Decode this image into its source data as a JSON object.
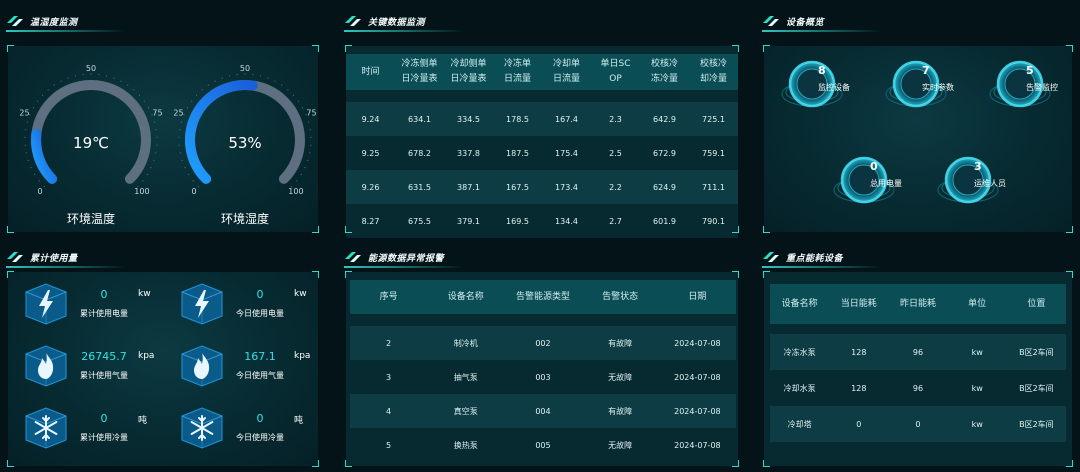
{
  "panels": {
    "temp_humidity": "温湿度监测",
    "key_data": "关键数据监测",
    "device_overview": "设备概览",
    "cumulative_usage": "累计使用量",
    "energy_alarm": "能源数据异常报警",
    "key_devices": "重点能耗设备"
  },
  "gauges": [
    {
      "value_text": "19℃",
      "label": "环境温度",
      "fraction": 0.19,
      "ticks": [
        "0",
        "25",
        "50",
        "75",
        "100"
      ]
    },
    {
      "value_text": "53%",
      "label": "环境湿度",
      "fraction": 0.53,
      "ticks": [
        "0",
        "25",
        "50",
        "75",
        "100"
      ]
    }
  ],
  "key_table": {
    "headers": [
      "时间",
      "冷冻侧单日冷量表",
      "冷却侧单日冷量表",
      "冷冻单日流量",
      "冷却单日流量",
      "单日SCOP",
      "校核冷冻冷量",
      "校核冷却冷量"
    ],
    "header_lines": [
      [
        "时间"
      ],
      [
        "冷冻侧单",
        "日冷量表"
      ],
      [
        "冷却侧单",
        "日冷量表"
      ],
      [
        "冷冻单",
        "日流量"
      ],
      [
        "冷却单",
        "日流量"
      ],
      [
        "单日SC",
        "OP"
      ],
      [
        "校核冷",
        "冻冷量"
      ],
      [
        "校核冷",
        "却冷量"
      ]
    ],
    "rows": [
      [
        "9.24",
        "634.1",
        "334.5",
        "178.5",
        "167.4",
        "2.3",
        "642.9",
        "725.1"
      ],
      [
        "9.25",
        "678.2",
        "337.8",
        "187.5",
        "175.4",
        "2.5",
        "672.9",
        "759.1"
      ],
      [
        "9.26",
        "631.5",
        "387.1",
        "167.5",
        "173.4",
        "2.2",
        "624.9",
        "711.1"
      ],
      [
        "8.27",
        "675.5",
        "379.1",
        "169.5",
        "134.4",
        "2.7",
        "601.9",
        "790.1"
      ]
    ]
  },
  "overview": [
    {
      "num": "8",
      "label": "监控设备"
    },
    {
      "num": "7",
      "label": "实时参数"
    },
    {
      "num": "5",
      "label": "告警监控"
    },
    {
      "num": "0",
      "label": "总用电量"
    },
    {
      "num": "3",
      "label": "运维人员"
    }
  ],
  "usage": [
    {
      "num": "0",
      "unit": "kw",
      "label": "累计使用电量",
      "icon": "lightning-icon"
    },
    {
      "num": "0",
      "unit": "kw",
      "label": "今日使用电量",
      "icon": "lightning-icon"
    },
    {
      "num": "26745.7",
      "unit": "kpa",
      "label": "累计使用气量",
      "icon": "flame-icon"
    },
    {
      "num": "167.1",
      "unit": "kpa",
      "label": "今日使用气量",
      "icon": "flame-icon"
    },
    {
      "num": "0",
      "unit": "吨",
      "label": "累计使用冷量",
      "icon": "snowflake-icon"
    },
    {
      "num": "0",
      "unit": "吨",
      "label": "今日使用冷量",
      "icon": "snowflake-icon"
    }
  ],
  "alarm_table": {
    "headers": [
      "序号",
      "设备名称",
      "告警能源类型",
      "告警状态",
      "日期"
    ],
    "rows": [
      [
        "2",
        "制冷机",
        "002",
        "有故障",
        "2024-07-08"
      ],
      [
        "3",
        "抽气泵",
        "003",
        "无故障",
        "2024-07-08"
      ],
      [
        "4",
        "真空泵",
        "004",
        "有故障",
        "2024-07-08"
      ],
      [
        "5",
        "换热泵",
        "005",
        "无故障",
        "2024-07-08"
      ]
    ]
  },
  "device_table": {
    "headers": [
      "设备名称",
      "当日能耗",
      "昨日能耗",
      "单位",
      "位置"
    ],
    "rows": [
      [
        "冷冻水泵",
        "128",
        "96",
        "kw",
        "B区2车间"
      ],
      [
        "冷却水泵",
        "128",
        "96",
        "kw",
        "B区2车间"
      ],
      [
        "冷却塔",
        "0",
        "0",
        "kw",
        "B区2车间"
      ]
    ]
  },
  "colors": {
    "accent": "#2fe3e8",
    "header_bg": "#0b4d55",
    "gauge_fill": "#1a7fe0",
    "gauge_track": "#5d6f80"
  }
}
